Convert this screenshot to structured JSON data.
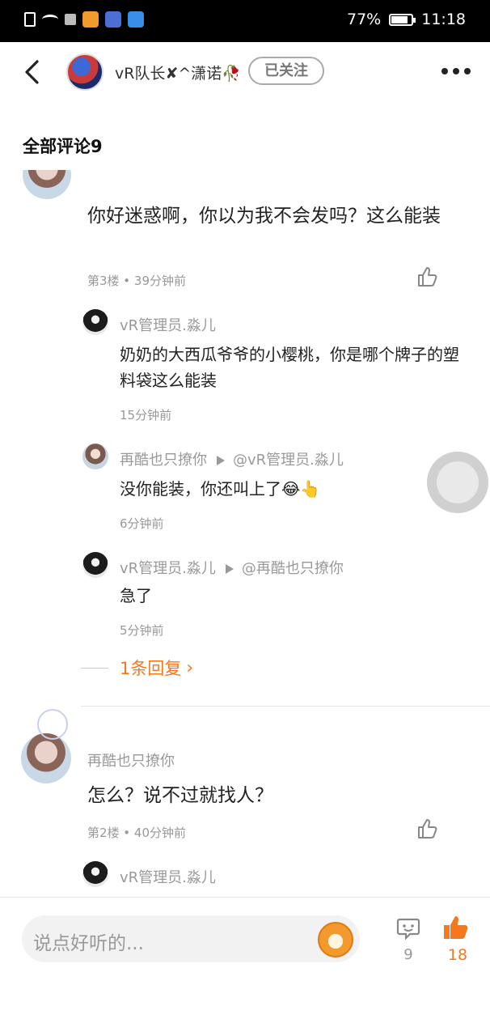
{
  "status_bar": {
    "battery": "77%",
    "time": "11:18",
    "battery_level": 0.77
  },
  "header": {
    "username": "vR队长✘^潇诺🥀",
    "follow_label": "已关注"
  },
  "section_title": "全部评论9",
  "comment1": {
    "text": "你好迷惑啊，你以为我不会发吗？这么能装",
    "meta": "第3楼 • 39分钟前",
    "replies": [
      {
        "name": "vR管理员.淼儿",
        "target": "",
        "text": "奶奶的大西瓜爷爷的小樱桃，你是哪个牌子的塑料袋这么能装",
        "time": "15分钟前"
      },
      {
        "name": "再酷也只撩你",
        "target": "@vR管理员.淼儿",
        "text": "没你能装，你还叫上了😂👆",
        "time": "6分钟前"
      },
      {
        "name": "vR管理员.淼儿",
        "target": "@再酷也只撩你",
        "text": "急了",
        "time": "5分钟前"
      }
    ],
    "more_replies": "1条回复"
  },
  "comment2": {
    "author": "再酷也只撩你",
    "text": "怎么？说不过就找人？",
    "meta": "第2楼 • 40分钟前",
    "reply_name": "vR管理员.淼儿"
  },
  "bottom": {
    "placeholder": "说点好听的...",
    "comment_count": "9",
    "like_count": "18"
  },
  "colors": {
    "accent": "#f5781e"
  }
}
